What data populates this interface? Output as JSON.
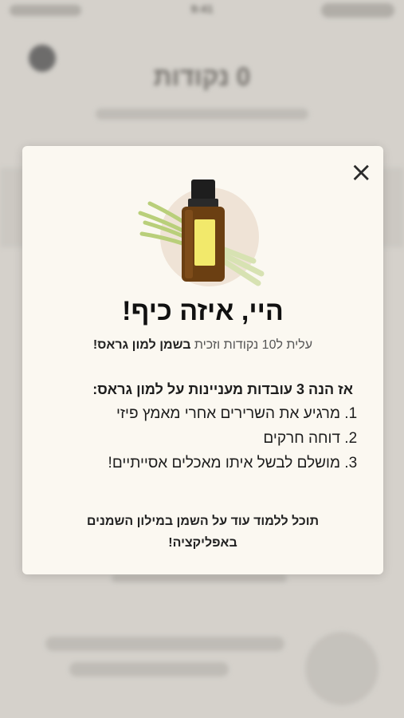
{
  "status_bar": {
    "time": "9:41"
  },
  "background": {
    "title": "0 נקודות"
  },
  "modal": {
    "title": "היי, איזה כיף!",
    "subtitle_prefix": "עלית ל10 נקודות וזכית ",
    "subtitle_bold": "בשמן למון גראס!",
    "facts_heading": "אז הנה 3 עובדות מעניינות על למון גראס:",
    "facts": [
      "מרגיע את השרירים אחרי מאמץ פיזי",
      "דוחה חרקים",
      "מושלם לבשל איתו מאכלים אסייתיים!"
    ],
    "footer_line1": "תוכל ללמוד עוד על השמן במילון השמנים",
    "footer_line2": "באפליקציה!",
    "close_icon": "×"
  },
  "colors": {
    "modal_bg": "#fbf8f1",
    "overlay": "#e9e6e0",
    "bottle_label": "#f2e96b"
  }
}
